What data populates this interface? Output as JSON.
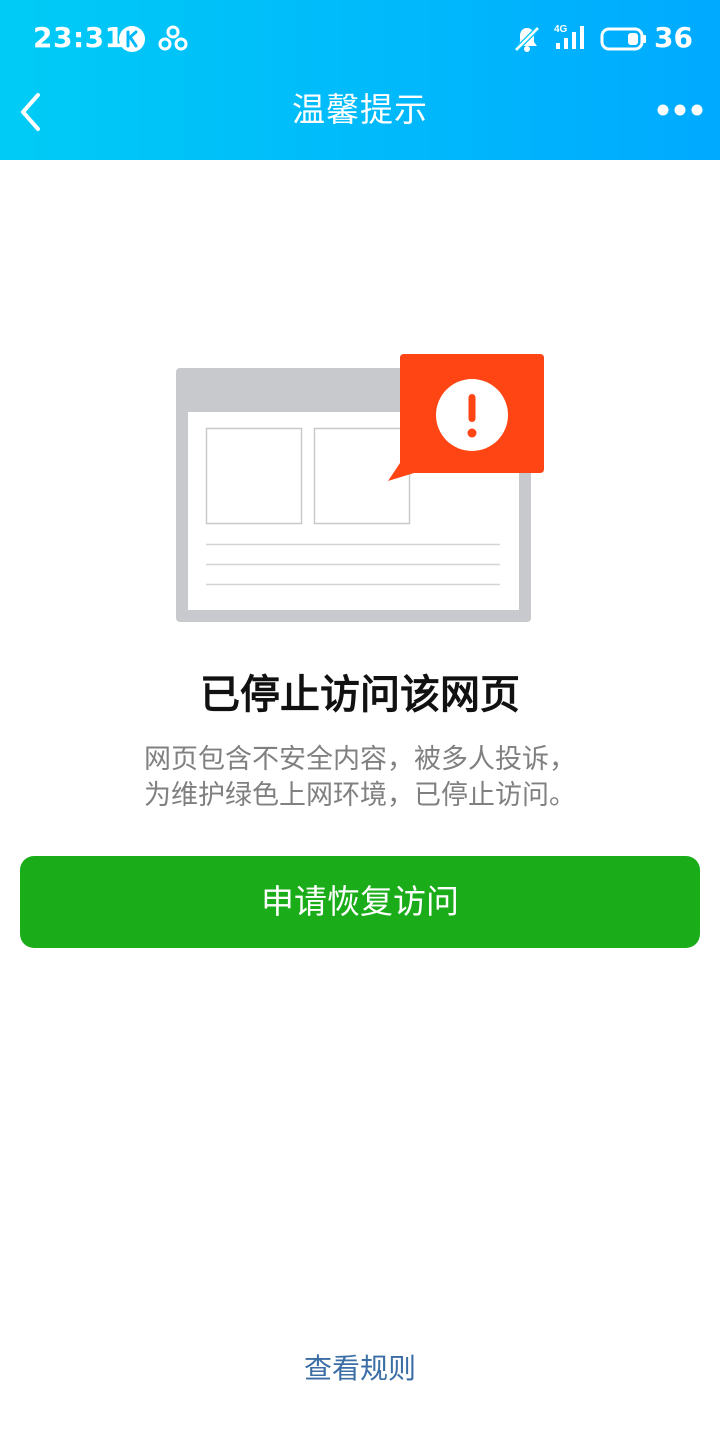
{
  "status_bar": {
    "time": "23:31",
    "network": "4G",
    "battery": "36",
    "icons": [
      "k-badge-icon",
      "connection-icon",
      "mute-bell-icon",
      "signal-icon",
      "battery-icon"
    ]
  },
  "nav": {
    "title": "温馨提示",
    "back_icon": "chevron-left-icon",
    "more_icon": "more-dots-icon"
  },
  "illustration": {
    "icon": "blocked-webpage-icon",
    "alert_color": "#ff4514"
  },
  "message": {
    "title": "已停止访问该网页",
    "line1": "网页包含不安全内容，被多人投诉，",
    "line2": "为维护绿色上网环境，已停止访问。"
  },
  "actions": {
    "primary_label": "申请恢复访问",
    "primary_color": "#1aad19",
    "rules_link": "查看规则",
    "link_color": "#3a6ea5"
  },
  "colors": {
    "header_start": "#00cbf6",
    "header_end": "#00aaff"
  }
}
